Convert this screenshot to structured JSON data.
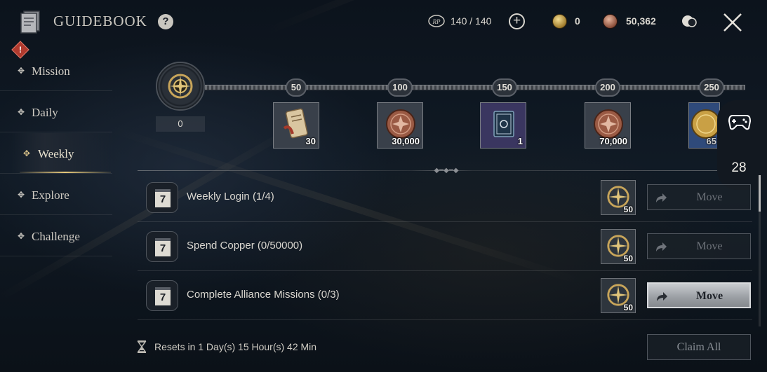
{
  "header": {
    "title": "GUIDEBOOK",
    "help_label": "?",
    "rp_value": "140 / 140",
    "plus_label": "+",
    "gold_value": "0",
    "copper_value": "50,362"
  },
  "sidebar": {
    "items": [
      {
        "label": "Mission"
      },
      {
        "label": "Daily"
      },
      {
        "label": "Weekly"
      },
      {
        "label": "Explore"
      },
      {
        "label": "Challenge"
      }
    ],
    "alert_label": "!"
  },
  "progress": {
    "current_points": "0",
    "milestones": [
      "50",
      "100",
      "150",
      "200",
      "250"
    ],
    "rewards": [
      {
        "amount": "30",
        "icon": "scroll-icon"
      },
      {
        "amount": "30,000",
        "icon": "copper-coin-icon"
      },
      {
        "amount": "1",
        "icon": "tome-icon"
      },
      {
        "amount": "70,000",
        "icon": "copper-coin-icon"
      },
      {
        "amount": "65",
        "icon": "gold-coin-icon"
      }
    ]
  },
  "float_panel": {
    "count": "28",
    "icon": "gamepad-icon"
  },
  "missions": [
    {
      "icon_label": "7",
      "text": "Weekly Login (1/4)",
      "reward": "50",
      "button": "Move",
      "active": false
    },
    {
      "icon_label": "7",
      "text": "Spend Copper (0/50000)",
      "reward": "50",
      "button": "Move",
      "active": false
    },
    {
      "icon_label": "7",
      "text": "Complete Alliance Missions (0/3)",
      "reward": "50",
      "button": "Move",
      "active": true
    }
  ],
  "footer": {
    "reset_text": "Resets in 1 Day(s) 15 Hour(s) 42 Min",
    "claim_all_label": "Claim All"
  },
  "colors": {
    "background": "#0f1821",
    "text": "#d9d6cf",
    "gold_accent": "#e6c97a",
    "alert": "#b03a2e"
  }
}
